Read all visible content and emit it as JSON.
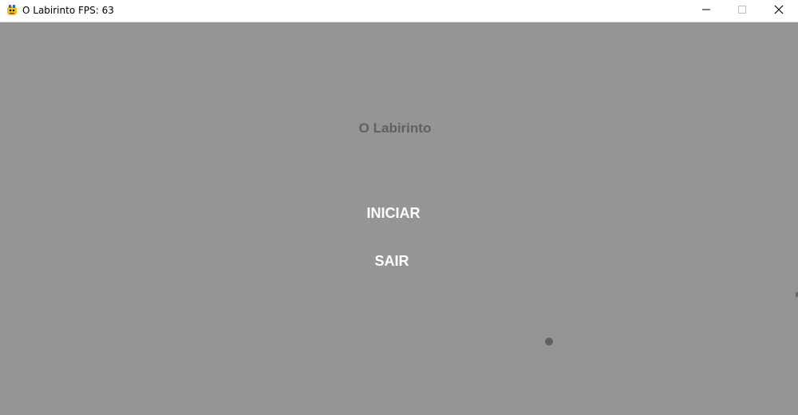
{
  "window": {
    "title": "O Labirinto FPS: 63",
    "icon": "pygame-snake-icon",
    "controls": {
      "minimize_icon": "minimize-icon",
      "maximize_icon": "maximize-icon",
      "close_icon": "close-icon"
    }
  },
  "colors": {
    "background": "#959595",
    "title_text": "#5d6260",
    "menu_text": "#ffffff",
    "player_dot": "#616161"
  },
  "menu": {
    "title": "O Labirinto",
    "options": [
      {
        "label": "INICIAR"
      },
      {
        "label": "SAIR"
      }
    ]
  }
}
